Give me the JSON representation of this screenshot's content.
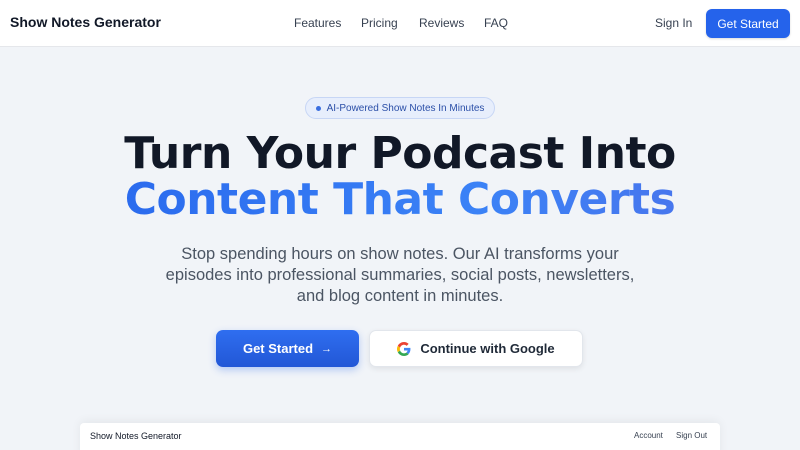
{
  "navbar": {
    "brand": "Show Notes Generator",
    "links": [
      "Features",
      "Pricing",
      "Reviews",
      "FAQ"
    ],
    "sign_in": "Sign In",
    "cta": "Get Started"
  },
  "hero": {
    "badge": "AI-Powered Show Notes In Minutes",
    "headline_line1": "Turn Your Podcast Into",
    "headline_line2": "Content That Converts",
    "subtitle": "Stop spending hours on show notes. Our AI transforms your episodes into professional summaries, social posts, newsletters, and blog content in minutes.",
    "primary_button": "Get Started",
    "primary_button_icon": "arrow-right-icon",
    "google_button": "Continue with Google",
    "google_button_icon": "google-icon"
  },
  "preview": {
    "brand": "Show Notes Generator",
    "account": "Account",
    "sign_out": "Sign Out"
  },
  "colors": {
    "accent": "#2563eb",
    "background": "#f1f4f8",
    "headline": "#111827"
  }
}
